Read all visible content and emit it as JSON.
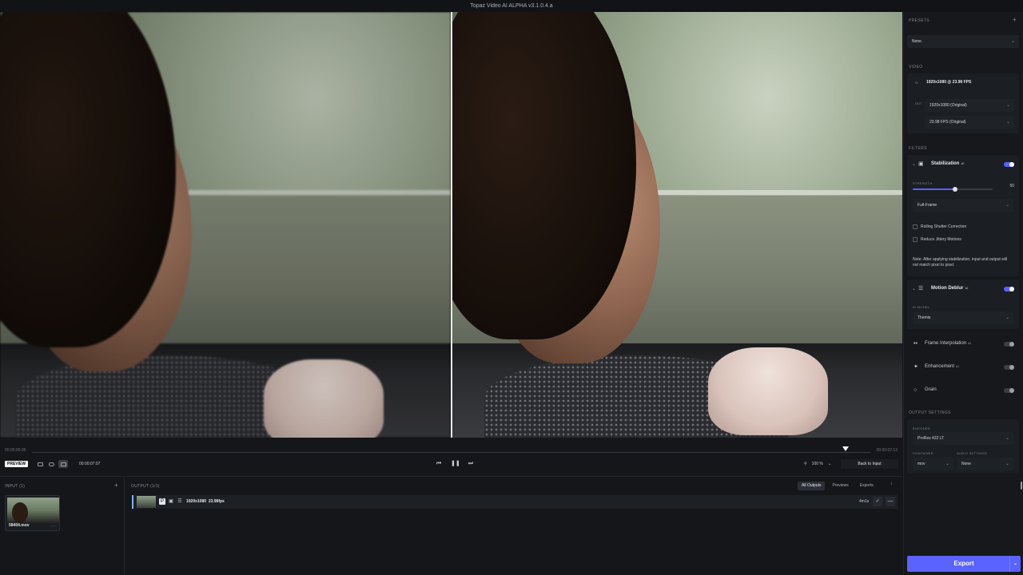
{
  "window": {
    "title": "Topaz Video AI ALPHA  v3.1.0.4.a"
  },
  "timeline": {
    "start_time": "00:00:00:00",
    "end_time": "00:00:07:12",
    "preview_label": "PREVIEW",
    "current_timecode": "00:00:07:07",
    "prev_frame_glyph": "⏮",
    "pause_glyph": "❚❚",
    "next_frame_glyph": "⏭",
    "zoom_level": "100 %",
    "back_to_input_label": "Back to Input"
  },
  "input_panel": {
    "title": "INPUT (1)",
    "add_glyph": "+",
    "file_name": "58404.mov",
    "more_glyph": "···"
  },
  "output_panel": {
    "title": "OUTPUT (1/1)",
    "tabs": [
      {
        "label": "All Outputs",
        "active": true
      },
      {
        "label": "Previews",
        "active": false
      },
      {
        "label": "Exports",
        "active": false
      }
    ],
    "sort_glyph": "↕",
    "row": {
      "resolution": "1920x1080",
      "fps": "23.98fps",
      "eta": "4m1s",
      "check_glyph": "✓",
      "remove_glyph": "—"
    }
  },
  "sidebar": {
    "presets": {
      "title": "PRESETS",
      "add_glyph": "+",
      "value": "None"
    },
    "video": {
      "title": "VIDEO",
      "in_tag": "IN",
      "in_value": "1920x1080 @ 23.98 FPS",
      "out_tag": "OUT",
      "out_resolution": "1920x1080 (Original)",
      "out_fps": "23.98 FPS (Original)"
    },
    "filters": {
      "title": "FILTERS",
      "stabilization": {
        "name": "Stabilization",
        "ai_tag": "AI",
        "enabled": true,
        "strength_label": "STRENGTH",
        "strength_value": "50",
        "strength_fraction": 0.5,
        "mode": "Full-Frame",
        "rolling_shutter_label": "Rolling Shutter Correction",
        "reduce_jitter_label": "Reduce Jittery Motions",
        "note": "Note: After applying stabilization, input and output will not match pixel to pixel."
      },
      "motion_deblur": {
        "name": "Motion Deblur",
        "ai_tag": "AI",
        "enabled": true,
        "model_label": "AI MODEL",
        "model_value": "Themis"
      },
      "frame_interpolation": {
        "name": "Frame Interpolation",
        "ai_tag": "AI",
        "enabled": false
      },
      "enhancement": {
        "name": "Enhancement",
        "ai_tag": "AI",
        "enabled": false
      },
      "grain": {
        "name": "Grain",
        "enabled": false
      }
    },
    "output_settings": {
      "title": "OUTPUT SETTINGS",
      "encoder_label": "ENCODER",
      "encoder_value": "ProRes 422 LT",
      "container_label": "CONTAINER",
      "container_value": "mov",
      "audio_label": "AUDIO SETTINGS",
      "audio_value": "None"
    },
    "export_label": "Export",
    "chevron_glyph": "⌄"
  },
  "colors": {
    "accent": "#5a62ff",
    "background": "#141619",
    "sidebar": "#16181b"
  }
}
